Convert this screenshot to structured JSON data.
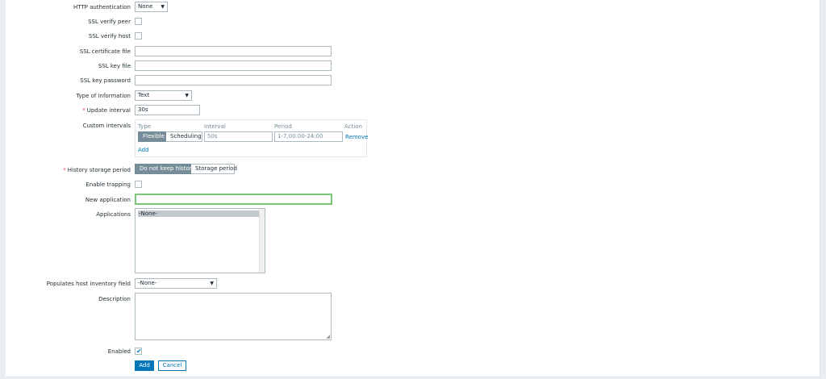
{
  "form": {
    "http_auth": {
      "label": "HTTP authentication",
      "value": "None"
    },
    "ssl_verify_peer": {
      "label": "SSL verify peer"
    },
    "ssl_verify_host": {
      "label": "SSL verify host"
    },
    "ssl_cert_file": {
      "label": "SSL certificate file",
      "value": ""
    },
    "ssl_key_file": {
      "label": "SSL key file",
      "value": ""
    },
    "ssl_key_password": {
      "label": "SSL key password",
      "value": ""
    },
    "type_of_information": {
      "label": "Type of information",
      "value": "Text"
    },
    "update_interval": {
      "required_mark": "*",
      "label": "Update interval",
      "value": "30s"
    },
    "custom_intervals": {
      "label": "Custom intervals",
      "headers": {
        "type": "Type",
        "interval": "Interval",
        "period": "Period",
        "action": "Action"
      },
      "row": {
        "type_options": [
          "Flexible",
          "Scheduling"
        ],
        "interval": "50s",
        "period": "1-7,00:00-24:00",
        "remove": "Remove"
      },
      "add": "Add"
    },
    "history_storage": {
      "required_mark": "*",
      "label": "History storage period",
      "options": [
        "Do not keep history",
        "Storage period"
      ]
    },
    "enable_trapping": {
      "label": "Enable trapping"
    },
    "new_application": {
      "label": "New application",
      "value": ""
    },
    "applications": {
      "label": "Applications",
      "options": [
        "-None-"
      ]
    },
    "populates_inventory": {
      "label": "Populates host inventory field",
      "value": "-None-"
    },
    "description": {
      "label": "Description",
      "value": ""
    },
    "enabled": {
      "label": "Enabled",
      "checked": true
    }
  },
  "buttons": {
    "add": "Add",
    "cancel": "Cancel"
  },
  "icons": {
    "dropdown": "chevron-down-icon",
    "check": "check-icon"
  },
  "colors": {
    "primary": "#0275b8",
    "segment_active": "#768d99",
    "focus_border": "#7bc57b"
  }
}
